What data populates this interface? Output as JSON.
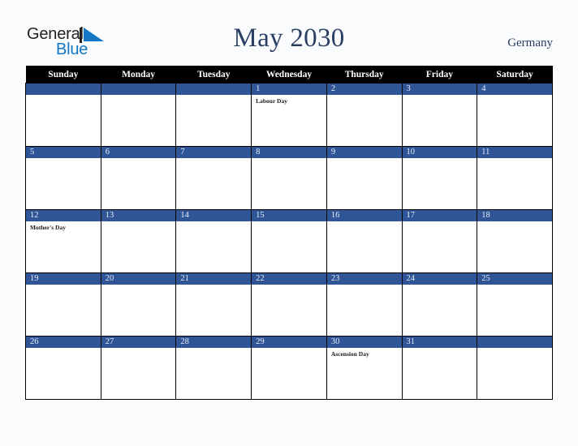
{
  "brand": {
    "line1": "General",
    "line2": "Blue",
    "triangle_color": "#1277c4",
    "line1_color": "#231f20",
    "line2_color": "#1277c4",
    "logo_icon": "general-blue-logo"
  },
  "header": {
    "title": "May 2030",
    "country": "Germany",
    "title_color": "#2a3f63"
  },
  "calendar": {
    "month": "May",
    "year": "2030",
    "accent_color": "#2f5597",
    "header_bg": "#000000",
    "header_text_color": "#ffffff",
    "weekdays": [
      "Sunday",
      "Monday",
      "Tuesday",
      "Wednesday",
      "Thursday",
      "Friday",
      "Saturday"
    ],
    "weeks": [
      [
        {
          "day": "",
          "events": []
        },
        {
          "day": "",
          "events": []
        },
        {
          "day": "",
          "events": []
        },
        {
          "day": "1",
          "events": [
            "Labour Day"
          ]
        },
        {
          "day": "2",
          "events": []
        },
        {
          "day": "3",
          "events": []
        },
        {
          "day": "4",
          "events": []
        }
      ],
      [
        {
          "day": "5",
          "events": []
        },
        {
          "day": "6",
          "events": []
        },
        {
          "day": "7",
          "events": []
        },
        {
          "day": "8",
          "events": []
        },
        {
          "day": "9",
          "events": []
        },
        {
          "day": "10",
          "events": []
        },
        {
          "day": "11",
          "events": []
        }
      ],
      [
        {
          "day": "12",
          "events": [
            "Mother's Day"
          ]
        },
        {
          "day": "13",
          "events": []
        },
        {
          "day": "14",
          "events": []
        },
        {
          "day": "15",
          "events": []
        },
        {
          "day": "16",
          "events": []
        },
        {
          "day": "17",
          "events": []
        },
        {
          "day": "18",
          "events": []
        }
      ],
      [
        {
          "day": "19",
          "events": []
        },
        {
          "day": "20",
          "events": []
        },
        {
          "day": "21",
          "events": []
        },
        {
          "day": "22",
          "events": []
        },
        {
          "day": "23",
          "events": []
        },
        {
          "day": "24",
          "events": []
        },
        {
          "day": "25",
          "events": []
        }
      ],
      [
        {
          "day": "26",
          "events": []
        },
        {
          "day": "27",
          "events": []
        },
        {
          "day": "28",
          "events": []
        },
        {
          "day": "29",
          "events": []
        },
        {
          "day": "30",
          "events": [
            "Ascension Day"
          ]
        },
        {
          "day": "31",
          "events": []
        },
        {
          "day": "",
          "events": []
        }
      ]
    ]
  }
}
